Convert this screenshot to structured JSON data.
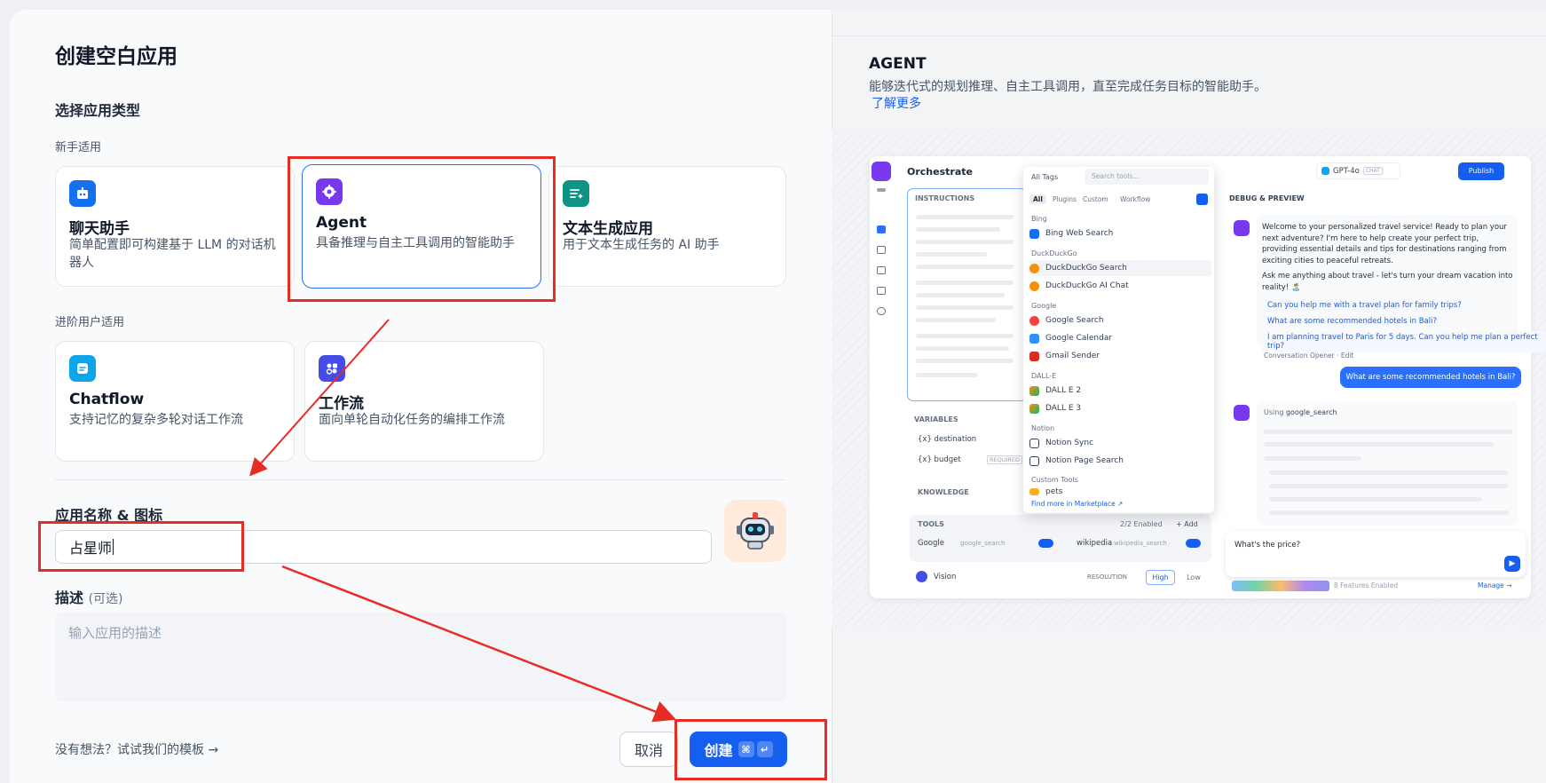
{
  "dialog": {
    "title": "创建空白应用"
  },
  "type_section": {
    "title": "选择应用类型",
    "beginner_label": "新手适用",
    "advanced_label": "进阶用户适用",
    "cards": [
      {
        "key": "chat",
        "title": "聊天助手",
        "desc": "简单配置即可构建基于 LLM 的对话机器人",
        "icon": "chat-bot-icon",
        "color": "#1570ef"
      },
      {
        "key": "agent",
        "title": "Agent",
        "desc": "具备推理与自主工具调用的智能助手",
        "icon": "agent-icon",
        "color": "#7839ee",
        "selected": true
      },
      {
        "key": "completion",
        "title": "文本生成应用",
        "desc": "用于文本生成任务的 AI 助手",
        "icon": "text-generation-icon",
        "color": "#0e9384"
      },
      {
        "key": "chatflow",
        "title": "Chatflow",
        "desc": "支持记忆的复杂多轮对话工作流",
        "icon": "chatflow-icon",
        "color": "#0ba5ec"
      },
      {
        "key": "workflow",
        "title": "工作流",
        "desc": "面向单轮自动化任务的编排工作流",
        "icon": "workflow-icon",
        "color": "#444ce7"
      }
    ]
  },
  "name_section": {
    "label": "应用名称 & 图标",
    "value": "占星师",
    "icon": "robot-avatar-icon",
    "icon_bg": "#ffeadb"
  },
  "desc_section": {
    "label": "描述",
    "optional": "(可选)",
    "placeholder": "输入应用的描述"
  },
  "footer": {
    "template_link": "没有想法？试试我们的模板",
    "cancel": "取消",
    "create": "创建",
    "shortcut_cmd": "⌘",
    "shortcut_enter": "↵"
  },
  "preview": {
    "title": "AGENT",
    "desc": "能够迭代式的规划推理、自主工具调用，直至完成任务目标的智能助手。",
    "learn_more": "了解更多",
    "mock": {
      "header": "Orchestrate",
      "instructions": "INSTRUCTIONS",
      "variables": "VARIABLES",
      "var1": "{x} destination",
      "var2": "{x} budget",
      "required": "REQUIRED",
      "knowledge": "KNOWLEDGE",
      "tools": "TOOLS",
      "tools_enabled": "2/2 Enabled",
      "add": "+ Add",
      "tool1": "Google",
      "tool1_id": "google_search",
      "tool2": "wikipedia",
      "tool2_id": "wikipedia_search",
      "vision": "Vision",
      "resolution": "RESOLUTION",
      "high": "High",
      "low": "Low",
      "all_tags": "All Tags",
      "search_tools": "Search tools...",
      "tabs": [
        "All",
        "Plugins",
        "Custom",
        "Workflow"
      ],
      "groups": [
        {
          "name": "Bing",
          "items": [
            "Bing Web Search"
          ]
        },
        {
          "name": "DuckDuckGo",
          "items": [
            "DuckDuckGo Search",
            "DuckDuckGo AI Chat"
          ]
        },
        {
          "name": "Google",
          "items": [
            "Google Search",
            "Google Calendar",
            "Gmail Sender"
          ]
        },
        {
          "name": "DALL-E",
          "items": [
            "DALL E 2",
            "DALL E 3"
          ]
        },
        {
          "name": "Notion",
          "items": [
            "Notion Sync",
            "Notion Page Search"
          ]
        },
        {
          "name": "Custom Tools",
          "items": [
            "pets"
          ]
        }
      ],
      "marketplace": "Find more in Marketplace ↗",
      "model": "GPT-4o",
      "model_tag": "CHAT",
      "publish": "Publish",
      "debug": "DEBUG & PREVIEW",
      "welcome": "Welcome to your personalized travel service! Ready to plan your next adventure? I'm here to help create your perfect trip, providing essential details and tips for destinations ranging from exciting cities to peaceful retreats.",
      "welcome2": "Ask me anything about travel - let's turn your dream vacation into reality! 🏝️",
      "suggestions": [
        "Can you help me with a travel plan for family trips?",
        "What are some recommended hotels in Bali?",
        "I am planning travel to Paris for 5 days. Can you help me plan a perfect trip?"
      ],
      "opener": "Conversation Opener · Edit",
      "user_msg": "What are some recommended hotels in Bali?",
      "using": "Using",
      "using_tool": "google_search",
      "input": "What's the price?",
      "features": "8 Features Enabled",
      "manage": "Manage →"
    }
  }
}
